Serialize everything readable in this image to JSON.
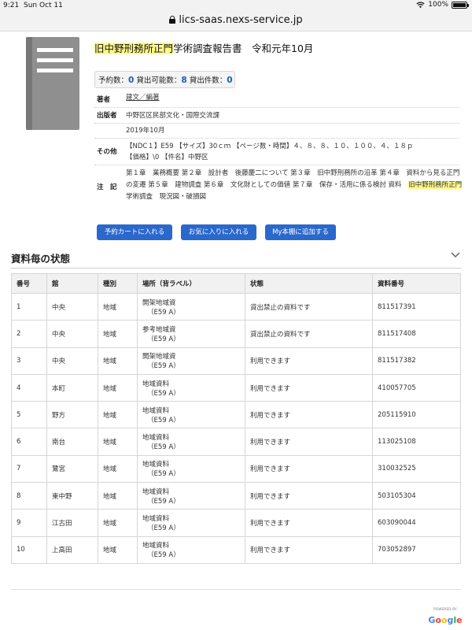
{
  "status_bar": {
    "time": "9:21",
    "date": "Sun Oct 11",
    "battery": "100%"
  },
  "browser": {
    "url": "lics-saas.nexs-service.jp"
  },
  "book": {
    "title_highlight": "旧中野刑務所正門",
    "title_rest": "学術調査報告書　令和元年10月",
    "counts": {
      "reserve_label": "予約数：",
      "reserve_value": "0",
      "available_label": "貸出可能数：",
      "available_value": "8",
      "loaned_label": "貸出件数：",
      "loaned_value": "0"
    },
    "author_label": "著者",
    "author_value": "建文／編著",
    "publisher_label": "出版者",
    "publisher_value": "中野区区民部文化・国際交流課",
    "date_value": "2019年10月",
    "other_label": "その他",
    "other_line1": "【NDC１】E59 【サイズ】30ｃｍ 【ページ数・時間】４、８、８、１０、１００、４、１８ｐ",
    "other_line2": "【価格】\\0 【件名】中野区",
    "notes_label": "注　記",
    "notes_line1": "第１章　業務概要 第２章　設計者　後藤慶二について 第３章　旧中野刑務所の沿革 第４章　資料から見る正門",
    "notes_line2": "の変遷 第５章　建物調査 第６章　文化財としての価値 第７章　保存・活用に係る検討 資料　",
    "notes_highlight": "旧中野刑務所正門",
    "notes_line3": "学術調査　現況図・破損図"
  },
  "buttons": {
    "reserve_cart": "予約カートに入れる",
    "favorites": "お気に入りに入れる",
    "my_shelf": "My本棚に追加する"
  },
  "holdings": {
    "heading": "資料毎の状態",
    "columns": [
      "番号",
      "館",
      "種別",
      "場所（背ラベル）",
      "状態",
      "資料番号"
    ],
    "rows": [
      {
        "no": "1",
        "branch": "中央",
        "type": "地域",
        "location": "開架地域資",
        "label": "（E59 A）",
        "status": "貸出禁止の資料です",
        "id": "811517391"
      },
      {
        "no": "2",
        "branch": "中央",
        "type": "地域",
        "location": "参考地域資",
        "label": "（E59 A）",
        "status": "貸出禁止の資料です",
        "id": "811517408"
      },
      {
        "no": "3",
        "branch": "中央",
        "type": "地域",
        "location": "開架地域資",
        "label": "（E59 A）",
        "status": "利用できます",
        "id": "811517382"
      },
      {
        "no": "4",
        "branch": "本町",
        "type": "地域",
        "location": "地域資料",
        "label": "（E59 A）",
        "status": "利用できます",
        "id": "410057705"
      },
      {
        "no": "5",
        "branch": "野方",
        "type": "地域",
        "location": "地域資料",
        "label": "（E59 A）",
        "status": "利用できます",
        "id": "205115910"
      },
      {
        "no": "6",
        "branch": "南台",
        "type": "地域",
        "location": "地域資料",
        "label": "（E59 A）",
        "status": "利用できます",
        "id": "113025108"
      },
      {
        "no": "7",
        "branch": "鷺宮",
        "type": "地域",
        "location": "地域資料",
        "label": "（E59 A）",
        "status": "利用できます",
        "id": "310032525"
      },
      {
        "no": "8",
        "branch": "東中野",
        "type": "地域",
        "location": "地域資料",
        "label": "（E59 A）",
        "status": "利用できます",
        "id": "503105304"
      },
      {
        "no": "9",
        "branch": "江古田",
        "type": "地域",
        "location": "地域資料",
        "label": "（E59 A）",
        "status": "利用できます",
        "id": "603090044"
      },
      {
        "no": "10",
        "branch": "上高田",
        "type": "地域",
        "location": "地域資料",
        "label": "（E59 A）",
        "status": "利用できます",
        "id": "703052897"
      }
    ]
  },
  "footer": {
    "powered_by": "POWERED BY",
    "google": "Google"
  },
  "colors": {
    "accent": "#2a68cc",
    "highlight": "#fffa8a",
    "link": "#1a5fb4"
  }
}
